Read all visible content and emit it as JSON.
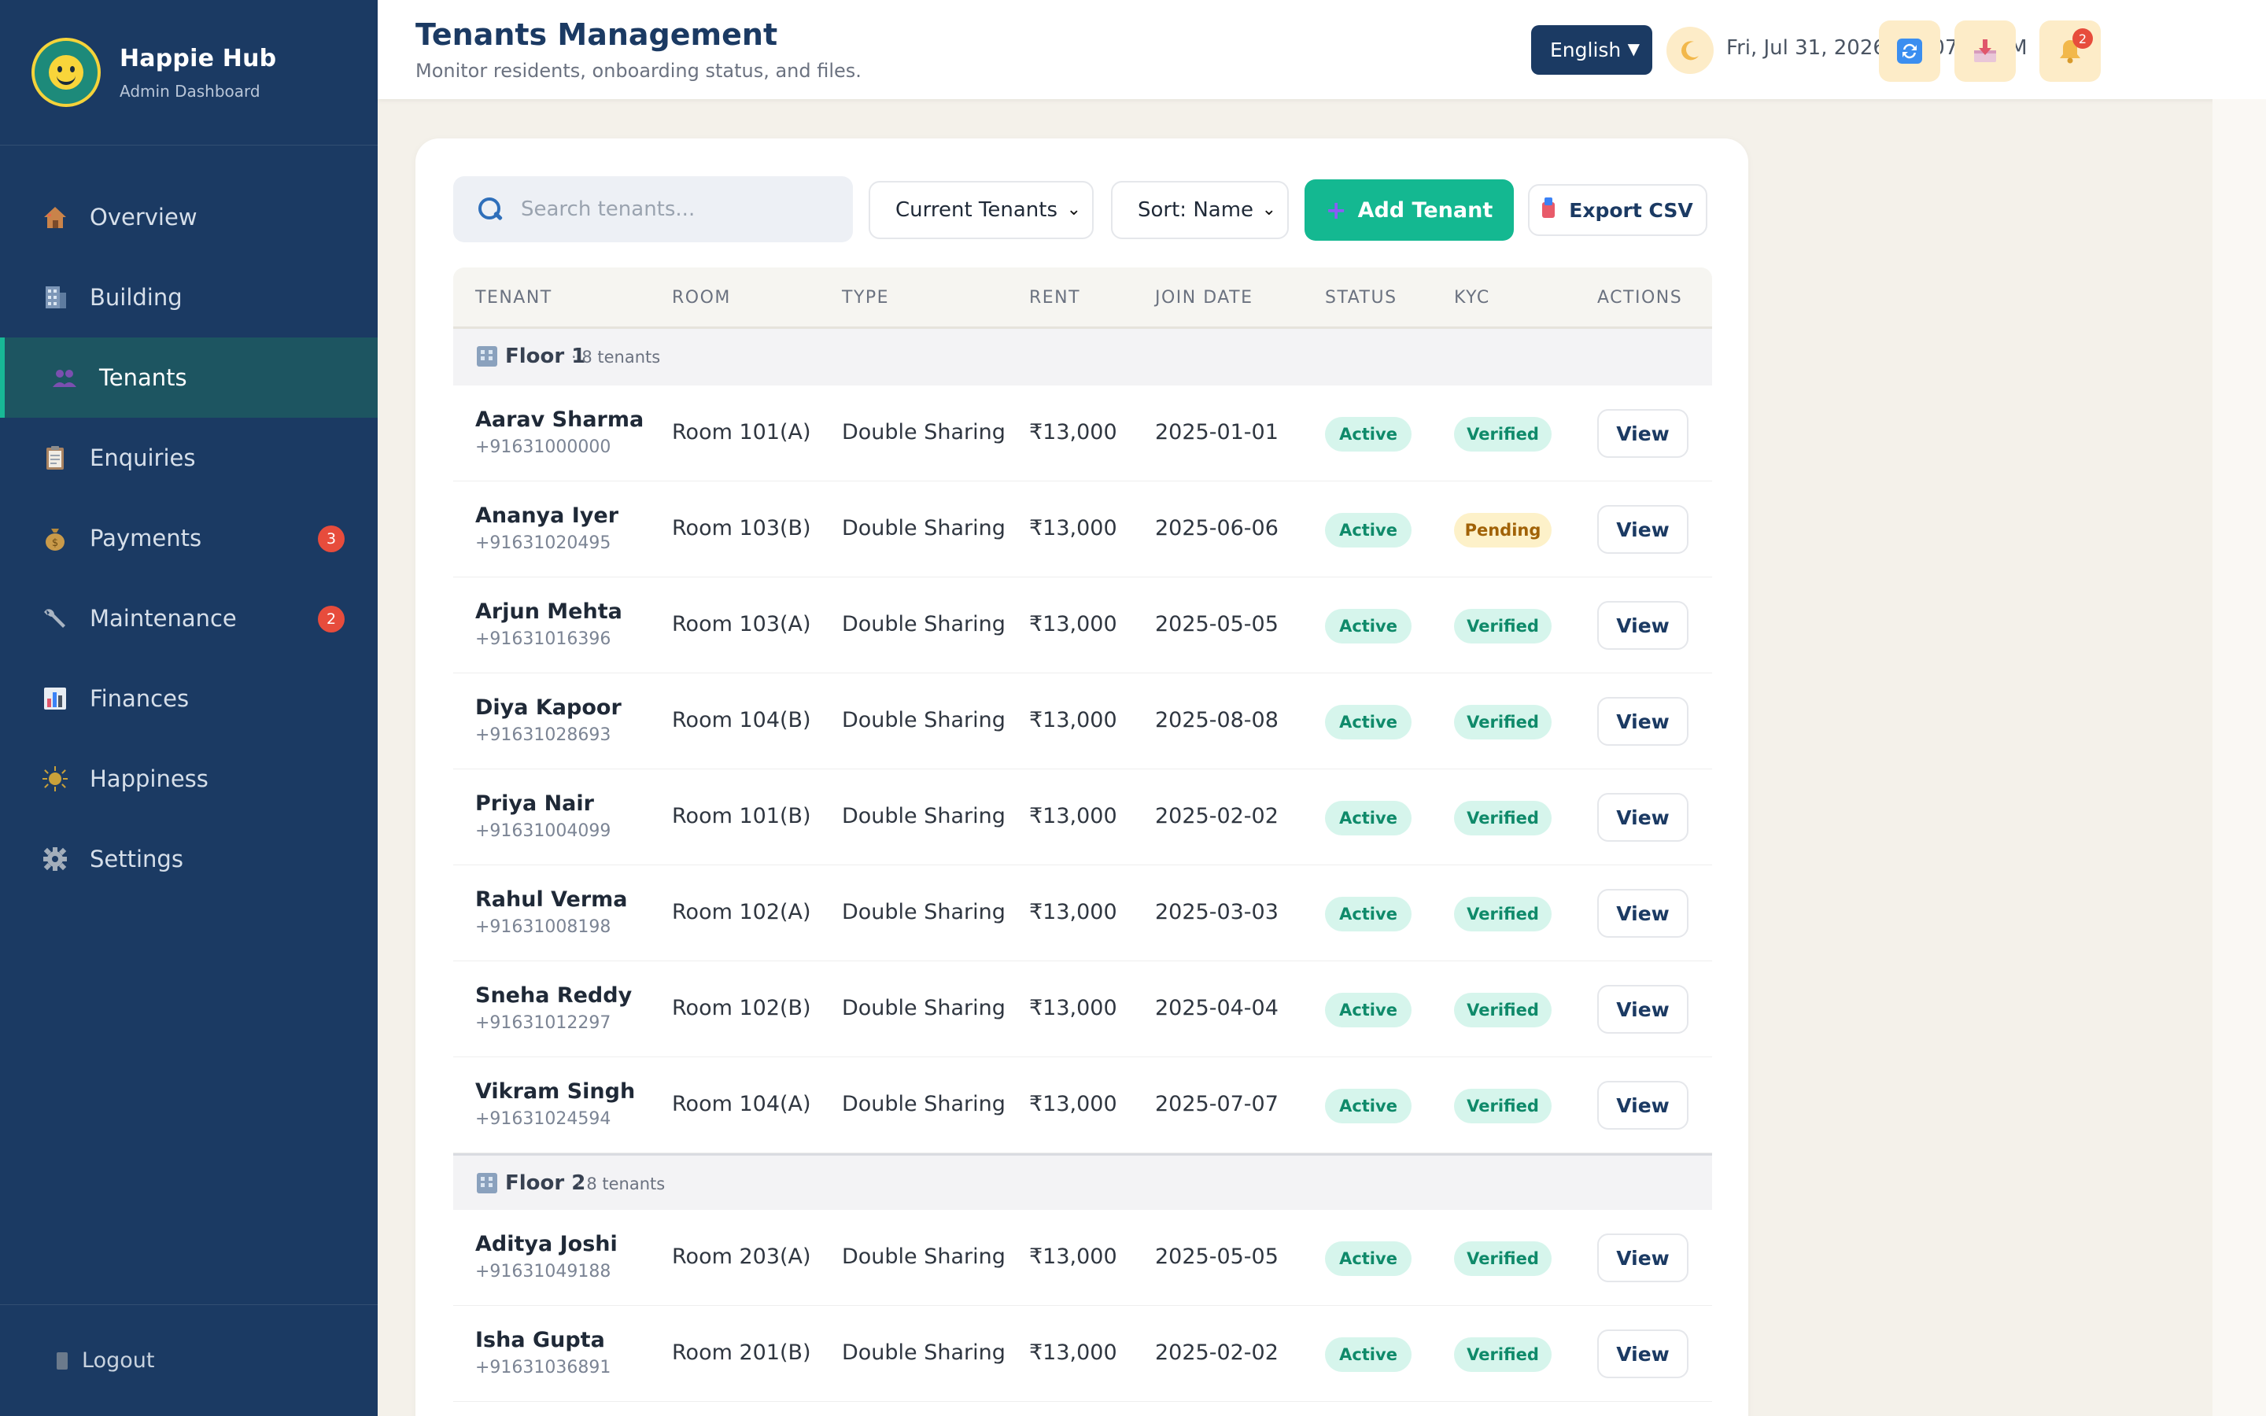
{
  "app": {
    "name": "Happie Hub",
    "subtitle": "Admin Dashboard"
  },
  "sidebar": {
    "items": [
      {
        "label": "Overview",
        "icon": "house-icon",
        "active": false
      },
      {
        "label": "Building",
        "icon": "building-icon",
        "active": false
      },
      {
        "label": "Tenants",
        "icon": "people-icon",
        "active": true
      },
      {
        "label": "Enquiries",
        "icon": "clipboard-icon",
        "active": false
      },
      {
        "label": "Payments",
        "icon": "money-bag-icon",
        "active": false,
        "badge": "3"
      },
      {
        "label": "Maintenance",
        "icon": "wrench-icon",
        "active": false,
        "badge": "2"
      },
      {
        "label": "Finances",
        "icon": "bar-chart-icon",
        "active": false
      },
      {
        "label": "Happiness",
        "icon": "sun-icon",
        "active": false
      },
      {
        "label": "Settings",
        "icon": "gear-icon",
        "active": false
      }
    ],
    "logout": "Logout"
  },
  "header": {
    "title": "Tenants Management",
    "subtitle": "Monitor residents, onboarding status, and files.",
    "language": "English",
    "datetime": "Fri, Jul 31, 2026, 12:07:52 PM",
    "notification_count": "2"
  },
  "toolbar": {
    "search_placeholder": "Search tenants...",
    "filter_value": "Current Tenants",
    "sort_value": "Sort: Name",
    "add_label": "Add Tenant",
    "export_label": "Export CSV"
  },
  "table": {
    "columns": [
      "TENANT",
      "ROOM",
      "TYPE",
      "RENT",
      "JOIN DATE",
      "STATUS",
      "KYC",
      "ACTIONS"
    ],
    "action_label": "View",
    "floors": [
      {
        "name": "Floor 1",
        "count": "· 8 tenants",
        "rows": [
          {
            "name": "Aarav Sharma",
            "phone": "+91631000000",
            "room": "Room 101(A)",
            "type": "Double Sharing",
            "rent": "₹13,000",
            "join_date": "2025-01-01",
            "status": "Active",
            "kyc": "Verified"
          },
          {
            "name": "Ananya Iyer",
            "phone": "+91631020495",
            "room": "Room 103(B)",
            "type": "Double Sharing",
            "rent": "₹13,000",
            "join_date": "2025-06-06",
            "status": "Active",
            "kyc": "Pending"
          },
          {
            "name": "Arjun Mehta",
            "phone": "+91631016396",
            "room": "Room 103(A)",
            "type": "Double Sharing",
            "rent": "₹13,000",
            "join_date": "2025-05-05",
            "status": "Active",
            "kyc": "Verified"
          },
          {
            "name": "Diya Kapoor",
            "phone": "+91631028693",
            "room": "Room 104(B)",
            "type": "Double Sharing",
            "rent": "₹13,000",
            "join_date": "2025-08-08",
            "status": "Active",
            "kyc": "Verified"
          },
          {
            "name": "Priya Nair",
            "phone": "+91631004099",
            "room": "Room 101(B)",
            "type": "Double Sharing",
            "rent": "₹13,000",
            "join_date": "2025-02-02",
            "status": "Active",
            "kyc": "Verified"
          },
          {
            "name": "Rahul Verma",
            "phone": "+91631008198",
            "room": "Room 102(A)",
            "type": "Double Sharing",
            "rent": "₹13,000",
            "join_date": "2025-03-03",
            "status": "Active",
            "kyc": "Verified"
          },
          {
            "name": "Sneha Reddy",
            "phone": "+91631012297",
            "room": "Room 102(B)",
            "type": "Double Sharing",
            "rent": "₹13,000",
            "join_date": "2025-04-04",
            "status": "Active",
            "kyc": "Verified"
          },
          {
            "name": "Vikram Singh",
            "phone": "+91631024594",
            "room": "Room 104(A)",
            "type": "Double Sharing",
            "rent": "₹13,000",
            "join_date": "2025-07-07",
            "status": "Active",
            "kyc": "Verified"
          }
        ]
      },
      {
        "name": "Floor 2",
        "count": "· 8 tenants",
        "rows": [
          {
            "name": "Aditya Joshi",
            "phone": "+91631049188",
            "room": "Room 203(A)",
            "type": "Double Sharing",
            "rent": "₹13,000",
            "join_date": "2025-05-05",
            "status": "Active",
            "kyc": "Verified"
          },
          {
            "name": "Isha Gupta",
            "phone": "+91631036891",
            "room": "Room 201(B)",
            "type": "Double Sharing",
            "rent": "₹13,000",
            "join_date": "2025-02-02",
            "status": "Active",
            "kyc": "Verified"
          }
        ]
      }
    ]
  },
  "colors": {
    "sidebar_bg": "#1b3a63",
    "accent": "#14b891",
    "badge": "#e74c3c",
    "active_pill_bg": "#d6f5ec",
    "pending_pill_bg": "#fdf1c9"
  }
}
